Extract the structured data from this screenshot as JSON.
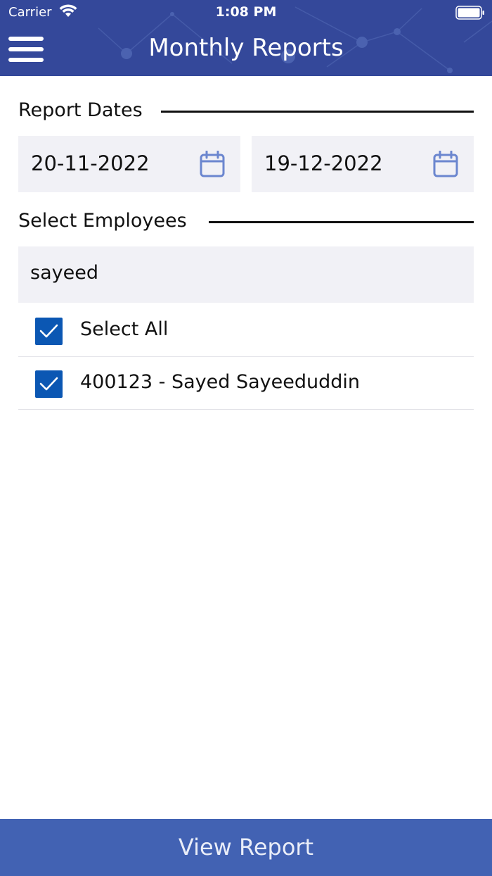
{
  "status_bar": {
    "carrier": "Carrier",
    "time": "1:08 PM"
  },
  "header": {
    "title": "Monthly Reports",
    "menu_icon": "hamburger-menu-icon",
    "background_color": "#34489a"
  },
  "report_dates": {
    "section_title": "Report Dates",
    "from_date": "20-11-2022",
    "to_date": "19-12-2022",
    "icon": "calendar-icon"
  },
  "employees": {
    "section_title": "Select Employees",
    "search_value": "sayeed",
    "select_all": {
      "label": "Select All",
      "checked": true
    },
    "items": [
      {
        "label": "400123 - Sayed Sayeeduddin",
        "checked": true
      }
    ]
  },
  "footer": {
    "view_report_label": "View Report",
    "button_color": "#4262b3"
  },
  "colors": {
    "checkbox": "#0b57b3",
    "field_background": "#f1f1f6",
    "calendar_icon": "#6b86cf"
  }
}
